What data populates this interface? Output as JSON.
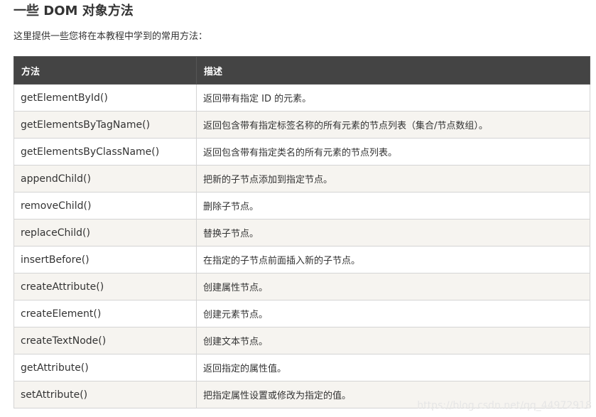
{
  "title": "一些 DOM 对象方法",
  "intro": "这里提供一些您将在本教程中学到的常用方法：",
  "table": {
    "headers": [
      "方法",
      "描述"
    ],
    "rows": [
      {
        "method": "getElementById()",
        "description": "返回带有指定 ID 的元素。"
      },
      {
        "method": "getElementsByTagName()",
        "description": "返回包含带有指定标签名称的所有元素的节点列表（集合/节点数组）。"
      },
      {
        "method": "getElementsByClassName()",
        "description": "返回包含带有指定类名的所有元素的节点列表。"
      },
      {
        "method": "appendChild()",
        "description": "把新的子节点添加到指定节点。"
      },
      {
        "method": "removeChild()",
        "description": "删除子节点。"
      },
      {
        "method": "replaceChild()",
        "description": "替换子节点。"
      },
      {
        "method": "insertBefore()",
        "description": "在指定的子节点前面插入新的子节点。"
      },
      {
        "method": "createAttribute()",
        "description": "创建属性节点。"
      },
      {
        "method": "createElement()",
        "description": "创建元素节点。"
      },
      {
        "method": "createTextNode()",
        "description": "创建文本节点。"
      },
      {
        "method": "getAttribute()",
        "description": "返回指定的属性值。"
      },
      {
        "method": "setAttribute()",
        "description": "把指定属性设置或修改为指定的值。"
      }
    ]
  },
  "watermark": "https://blog.csdn.net/qq_44972918"
}
